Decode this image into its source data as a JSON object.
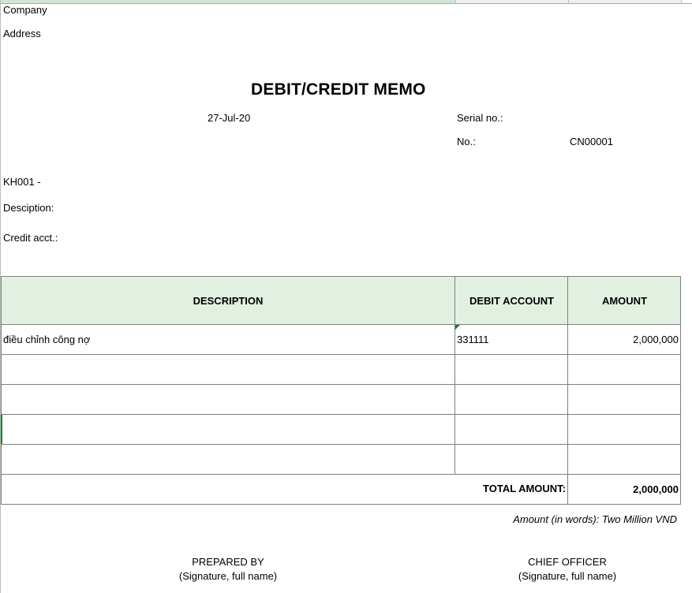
{
  "header": {
    "company_label": "Company",
    "address_label": "Address",
    "title": "DEBIT/CREDIT MEMO",
    "date": "27-Jul-20",
    "serial_label": "Serial  no.:",
    "no_label": "No.:",
    "no_value": "CN00001"
  },
  "details": {
    "customer": "KH001 -",
    "description_label": "Desciption:",
    "credit_acct_label": "Credit acct.:"
  },
  "table": {
    "columns": [
      "DESCRIPTION",
      "DEBIT ACCOUNT",
      "AMOUNT"
    ],
    "rows": [
      {
        "description": "điều chỉnh công nợ",
        "debit_account": "331111",
        "amount": "2,000,000"
      },
      {
        "description": "",
        "debit_account": "",
        "amount": ""
      },
      {
        "description": "",
        "debit_account": "",
        "amount": ""
      },
      {
        "description": "",
        "debit_account": "",
        "amount": ""
      },
      {
        "description": "",
        "debit_account": "",
        "amount": ""
      }
    ],
    "total_label": "TOTAL AMOUNT:",
    "total_value": "2,000,000"
  },
  "footer": {
    "amount_in_words": "Amount (in words): Two Million VND",
    "prepared_by": "PREPARED BY",
    "prepared_sig": "(Signature, full name)",
    "chief_officer": "CHIEF OFFICER",
    "chief_sig": "(Signature, full name)"
  }
}
